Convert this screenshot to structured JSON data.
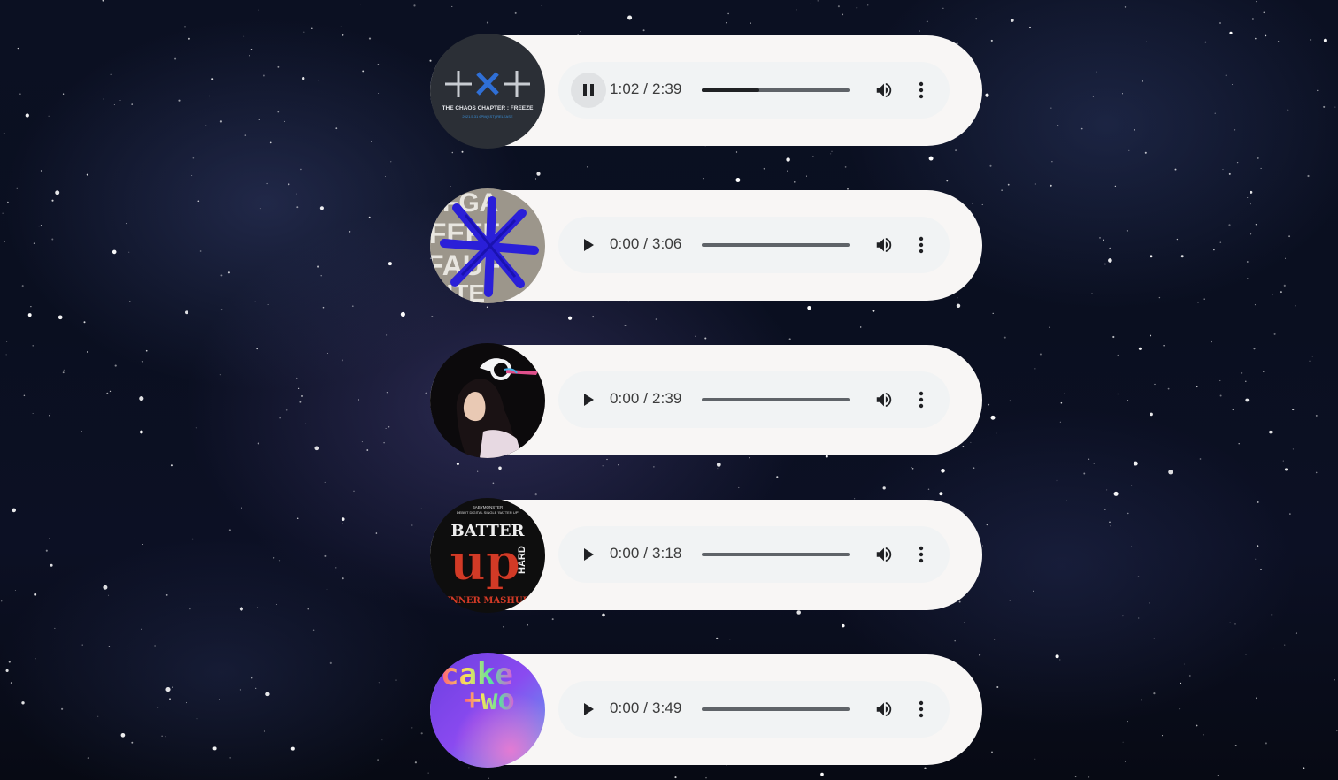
{
  "background": {
    "name": "starry-night-sky",
    "color": "#0b1022"
  },
  "tracks": [
    {
      "cover_art": {
        "type": "album-cover-minisode1",
        "logo": "+×+",
        "title": "THE CHAOS CHAPTER : FREEZE",
        "subtitle": "2021.5.31 6PM(KST) RELEASE"
      },
      "state": "playing",
      "time_label": "1:02 / 2:39",
      "progress": 0.39,
      "play_icon": "pause-icon"
    },
    {
      "cover_art": {
        "type": "album-cover-fight-or-escape",
        "text": "FIGHT OR ESCAPE"
      },
      "state": "paused",
      "time_label": "0:00 / 3:06",
      "progress": 0,
      "play_icon": "play-icon"
    },
    {
      "cover_art": {
        "type": "single-cover-portrait"
      },
      "state": "paused",
      "time_label": "0:00 / 2:39",
      "progress": 0,
      "play_icon": "play-icon"
    },
    {
      "cover_art": {
        "type": "single-cover-batter-up",
        "top_text": "BABYMONSTER",
        "sub_text": "DEBUT DIGITAL SINGLE 'BATTER UP'",
        "title": "BATTER",
        "main": "up",
        "side": "HARD",
        "bottom": "(FENNER MASHUP)"
      },
      "state": "paused",
      "time_label": "0:00 / 3:18",
      "progress": 0,
      "play_icon": "play-icon"
    },
    {
      "cover_art": {
        "type": "single-cover-cake-two",
        "line1": "cake",
        "line2": "+wo"
      },
      "state": "paused",
      "time_label": "0:00 / 3:49",
      "progress": 0,
      "play_icon": "play-icon"
    }
  ],
  "controls": {
    "volume_icon": "volume-icon",
    "more_icon": "more-options-icon"
  },
  "colors": {
    "card_bg": "#f8f6f5",
    "player_bg": "#f1f3f4",
    "active_button_bg": "#e0e2e4",
    "track_color": "#5f6368",
    "fill_color": "#202124"
  }
}
